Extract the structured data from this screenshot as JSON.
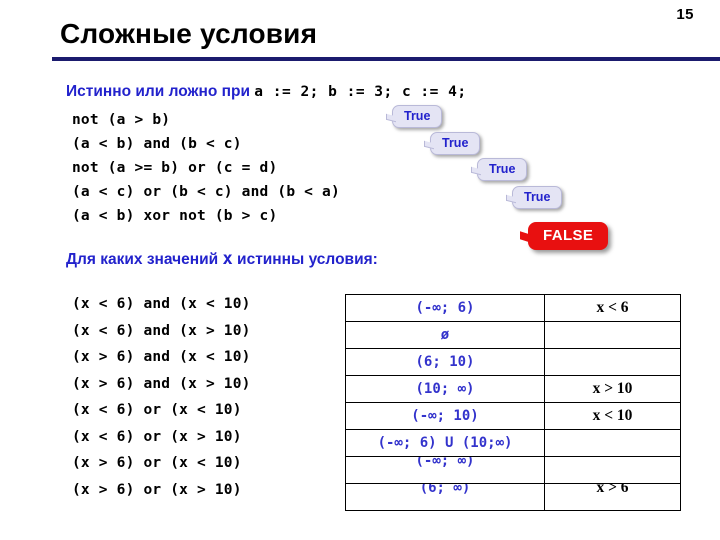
{
  "slide": {
    "page_number": "15",
    "title": "Сложные условия"
  },
  "section_one": {
    "prompt_text": "Истинно или ложно при",
    "prompt_values": "a := 2;  b := 3;  c := 4;",
    "expressions": [
      "not (a > b)",
      "(a < b) and (b < c)",
      "not (a >= b) or (c = d)",
      "(a < c) or (b < c) and (b < a)",
      "(a < b) xor not (b > c)"
    ],
    "callouts": [
      {
        "label": "True",
        "kind": "true"
      },
      {
        "label": "True",
        "kind": "true"
      },
      {
        "label": "True",
        "kind": "true"
      },
      {
        "label": "True",
        "kind": "true"
      },
      {
        "label": "FALSE",
        "kind": "false"
      }
    ]
  },
  "section_two": {
    "prompt_before": "Для каких значений ",
    "prompt_variable": "x",
    "prompt_after": " истинны условия:",
    "conditions": [
      "(x < 6) and (x < 10)",
      "(x < 6) and (x > 10)",
      "(x > 6) and (x < 10)",
      "(x > 6) and (x > 10)",
      "(x < 6) or (x < 10)",
      "(x < 6) or (x > 10)",
      "(x > 6) or (x < 10)",
      "(x > 6) or (x > 10)"
    ],
    "answer_table": {
      "rows": [
        {
          "interval": "(-∞; 6)",
          "inequality": "x < 6"
        },
        {
          "interval": "ø",
          "inequality": ""
        },
        {
          "interval": "(6; 10)",
          "inequality": ""
        },
        {
          "interval": "(10; ∞)",
          "inequality": "x > 10"
        },
        {
          "interval": "(-∞; 10)",
          "inequality": "x < 10"
        },
        {
          "interval": "(-∞; 6) U (10;∞)",
          "inequality": ""
        },
        {
          "interval": "(-∞; ∞)",
          "inequality": ""
        },
        {
          "interval": "(6; ∞)",
          "inequality": "x > 6"
        }
      ]
    }
  },
  "colors": {
    "accent_blue": "#2222cc",
    "rule_navy": "#1b1b6e",
    "false_red": "#e81010",
    "callout_fill": "#e4e4f4"
  }
}
